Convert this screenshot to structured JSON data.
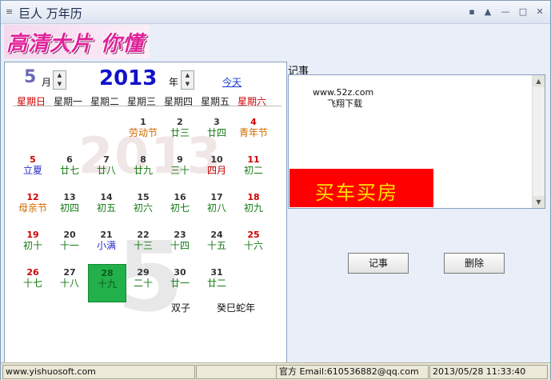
{
  "window": {
    "title": "巨人 万年历",
    "icon": "menu-icon"
  },
  "titlebar_buttons": {
    "menu": "▪",
    "up": "▲",
    "minimize": "—",
    "maximize": "□",
    "close": "✕"
  },
  "banner": {
    "text": "高清大片 你懂得"
  },
  "calendar": {
    "month": "5",
    "month_unit": "月",
    "year": "2013",
    "year_unit": "年",
    "today_link": "今天",
    "watermark_year": "2013",
    "watermark_month": "5",
    "weekdays": [
      "星期日",
      "星期一",
      "星期二",
      "星期三",
      "星期四",
      "星期五",
      "星期六"
    ],
    "rows": [
      [
        {
          "d": "",
          "l": ""
        },
        {
          "d": "",
          "l": ""
        },
        {
          "d": "",
          "l": ""
        },
        {
          "d": "1",
          "l": "劳动节",
          "ls": "orange"
        },
        {
          "d": "2",
          "l": "廿三"
        },
        {
          "d": "3",
          "l": "廿四"
        },
        {
          "d": "4",
          "l": "青年节",
          "ls": "orange",
          "ds": "red"
        }
      ],
      [
        {
          "d": "5",
          "l": "立夏",
          "ls": "blue",
          "ds": "red"
        },
        {
          "d": "6",
          "l": "廿七"
        },
        {
          "d": "7",
          "l": "廿八"
        },
        {
          "d": "8",
          "l": "廿九"
        },
        {
          "d": "9",
          "l": "三十"
        },
        {
          "d": "10",
          "l": "四月",
          "ls": "red"
        },
        {
          "d": "11",
          "l": "初二",
          "ds": "red"
        }
      ],
      [
        {
          "d": "12",
          "l": "母亲节",
          "ls": "orange",
          "ds": "red"
        },
        {
          "d": "13",
          "l": "初四"
        },
        {
          "d": "14",
          "l": "初五"
        },
        {
          "d": "15",
          "l": "初六"
        },
        {
          "d": "16",
          "l": "初七"
        },
        {
          "d": "17",
          "l": "初八"
        },
        {
          "d": "18",
          "l": "初九",
          "ds": "red"
        }
      ],
      [
        {
          "d": "19",
          "l": "初十",
          "ds": "red"
        },
        {
          "d": "20",
          "l": "十一"
        },
        {
          "d": "21",
          "l": "小满",
          "ls": "blue"
        },
        {
          "d": "22",
          "l": "十三"
        },
        {
          "d": "23",
          "l": "十四"
        },
        {
          "d": "24",
          "l": "十五"
        },
        {
          "d": "25",
          "l": "十六",
          "ds": "red"
        }
      ],
      [
        {
          "d": "26",
          "l": "十七",
          "ds": "red"
        },
        {
          "d": "27",
          "l": "十八"
        },
        {
          "d": "28",
          "l": "十九",
          "selected": true
        },
        {
          "d": "29",
          "l": "二十"
        },
        {
          "d": "30",
          "l": "廿一"
        },
        {
          "d": "31",
          "l": "廿二"
        },
        {
          "d": "",
          "l": ""
        }
      ]
    ],
    "zodiac_sign": "双子",
    "lunar_year": "癸巳蛇年"
  },
  "notes": {
    "label": "记事",
    "line1": "www.52z.com",
    "line2": "飞翔下载",
    "ad_text": "买车买房"
  },
  "buttons": {
    "note": "记事",
    "delete": "删除"
  },
  "status": {
    "website": "www.yishuosoft.com",
    "empty1": "",
    "empty2": "",
    "email": "官方 Email:610536882@qq.com",
    "datetime": "2013/05/28 11:33:40"
  },
  "colors": {
    "selected_day": "#22b04a",
    "year": "#1111cc",
    "holiday": "#d06a00",
    "weekend": "#d00000"
  }
}
